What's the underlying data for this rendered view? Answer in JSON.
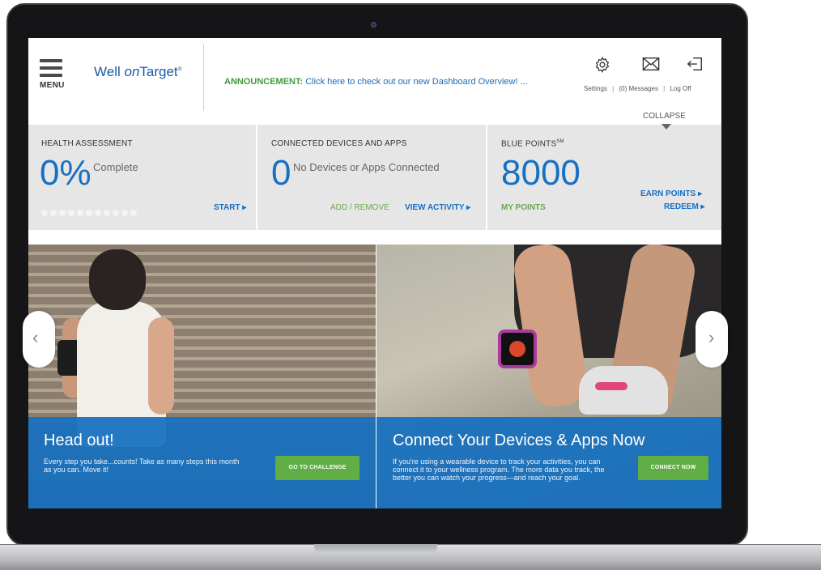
{
  "header": {
    "menu_label": "MENU",
    "logo_prefix": "Well ",
    "logo_on": "on",
    "logo_suffix": "Target",
    "logo_mark": "®",
    "announcement_label": "ANNOUNCEMENT:",
    "announcement_text": "Click here to check out our new Dashboard Overview! ...",
    "settings_label": "Settings",
    "messages_label": "(0) Messages",
    "logoff_label": "Log Off",
    "separator": "|",
    "collapse_label": "COLLAPSE"
  },
  "stats": {
    "health": {
      "title": "HEALTH ASSESSMENT",
      "value": "0%",
      "sub": "Complete",
      "progress_fraction": 0,
      "dots": 11,
      "start_label": "START ▸"
    },
    "devices": {
      "title": "CONNECTED DEVICES AND APPS",
      "value": "0",
      "sub": "No Devices or Apps Connected",
      "add_remove_label": "ADD / REMOVE",
      "view_activity_label": "VIEW ACTIVITY ▸"
    },
    "points": {
      "title": "BLUE POINTS",
      "title_mark": "SM",
      "value": "8000",
      "my_points_label": "MY POINTS",
      "earn_label": "EARN POINTS ▸",
      "redeem_label": "REDEEM ▸"
    }
  },
  "slides": [
    {
      "heading": "Head out!",
      "body": "Every step you take...counts! Take as many steps this month as you can. Move it!",
      "cta": "GO TO CHALLENGE"
    },
    {
      "heading": "Connect Your Devices & Apps Now",
      "body": "If you're using a wearable device to track your activities, you can connect it to your wellness program. The more data you track, the better you can watch your progress—and reach your goal.",
      "cta": "CONNECT NOW"
    }
  ],
  "carousel": {
    "prev_glyph": "‹",
    "next_glyph": "›"
  },
  "colors": {
    "brand_blue": "#1670c3",
    "brand_green": "#60ae45",
    "panel_blue": "#1670be"
  },
  "icons": [
    "menu-icon",
    "gear-icon",
    "envelope-icon",
    "logoff-icon",
    "chevron-left-icon",
    "chevron-right-icon"
  ]
}
